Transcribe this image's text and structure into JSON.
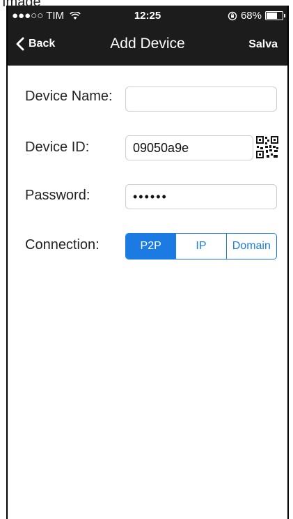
{
  "caption": "Image",
  "status_bar": {
    "carrier": "●●●○○ TIM",
    "time": "12:25",
    "battery": "68%",
    "battery_level": 0.68
  },
  "nav": {
    "back_label": "Back",
    "title": "Add Device",
    "save_label": "Salva"
  },
  "form": {
    "device_name": {
      "label": "Device Name:",
      "value": ""
    },
    "device_id": {
      "label": "Device ID:",
      "value": "09050a9e"
    },
    "password": {
      "label": "Password:",
      "value": "••••••"
    },
    "connection": {
      "label": "Connection:",
      "options": [
        "P2P",
        "IP",
        "Domain"
      ],
      "selected": "P2P"
    }
  },
  "colors": {
    "accent": "#1b7be3",
    "bar": "#1c1c1c"
  }
}
